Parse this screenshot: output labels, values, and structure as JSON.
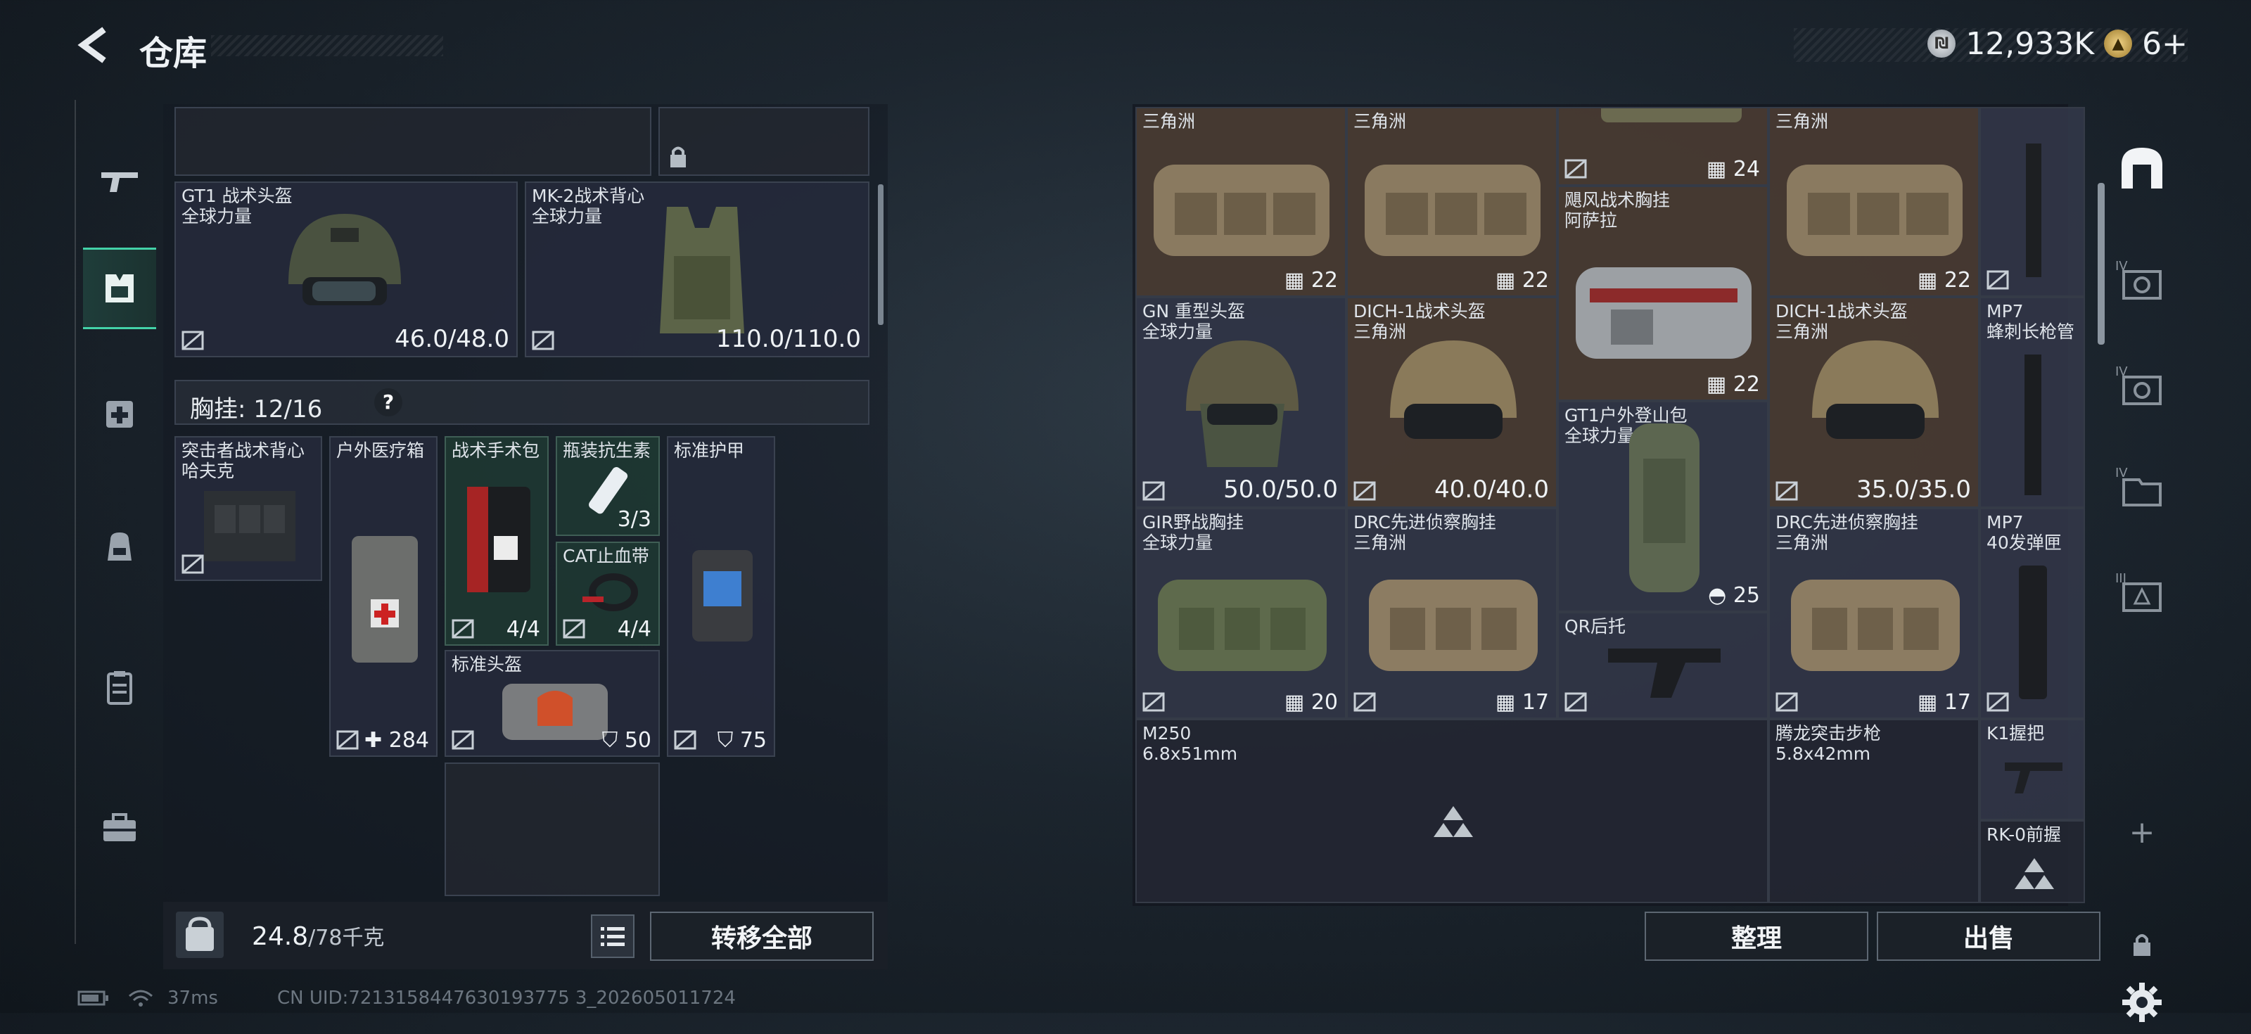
{
  "header": {
    "title": "仓库",
    "currencies": [
      {
        "icon": "silver-coin-icon",
        "value": "12,933K"
      },
      {
        "icon": "gold-coin-icon",
        "value": "6+"
      }
    ]
  },
  "left_nav": [
    {
      "name": "weapon-nav-icon"
    },
    {
      "name": "equipment-nav-icon",
      "active": true
    },
    {
      "name": "medical-nav-icon"
    },
    {
      "name": "backpack-nav-icon"
    },
    {
      "name": "clipboard-nav-icon"
    },
    {
      "name": "toolbox-nav-icon"
    }
  ],
  "equipment": {
    "helmet": {
      "name": "GT1 战术头盔",
      "sub": "全球力量",
      "durability": "46.0/48.0"
    },
    "armor": {
      "name": "MK-2战术背心",
      "sub": "全球力量",
      "durability": "110.0/110.0"
    },
    "chest_rig_label": "胸挂: 12/16",
    "chest_item": {
      "name": "突击者战术背心",
      "sub": "哈夫克"
    },
    "items": [
      {
        "name": "户外医疗箱",
        "value": "284"
      },
      {
        "name": "战术手术包",
        "value": "4/4"
      },
      {
        "name": "瓶装抗生素",
        "value": "3/3"
      },
      {
        "name": "CAT止血带",
        "value": "4/4"
      },
      {
        "name": "标准护甲",
        "value": "75"
      },
      {
        "name": "标准头盔",
        "value": "50"
      }
    ]
  },
  "bottom_left": {
    "weight": "24.8",
    "weight_unit": "/78千克",
    "transfer_all": "转移全部"
  },
  "storage": {
    "cells": [
      {
        "name": "三角洲",
        "value": "22"
      },
      {
        "name": "三角洲",
        "value": "22"
      },
      {
        "name": "",
        "value": "24"
      },
      {
        "name": "三角洲",
        "value": "22"
      },
      {
        "name": "飓风战术胸挂",
        "sub": "阿萨拉",
        "value": "22"
      },
      {
        "name": "GN 重型头盔",
        "sub": "全球力量",
        "value": "50.0/50.0"
      },
      {
        "name": "DICH-1战术头盔",
        "sub": "三角洲",
        "value": "40.0/40.0"
      },
      {
        "name": "DICH-1战术头盔",
        "sub": "三角洲",
        "value": "35.0/35.0"
      },
      {
        "name": "MP7",
        "sub": "蜂刺长枪管"
      },
      {
        "name": "GT1户外登山包",
        "sub": "全球力量",
        "value": "25"
      },
      {
        "name": "GIR野战胸挂",
        "sub": "全球力量",
        "value": "20"
      },
      {
        "name": "DRC先进侦察胸挂",
        "sub": "三角洲",
        "value": "17"
      },
      {
        "name": "DRC先进侦察胸挂",
        "sub": "三角洲",
        "value": "17"
      },
      {
        "name": "MP7",
        "sub": "40发弹匣"
      },
      {
        "name": "QR后托"
      },
      {
        "name": "M250",
        "sub": "6.8x51mm"
      },
      {
        "name": "腾龙突击步枪",
        "sub": "5.8x42mm"
      },
      {
        "name": "K1握把"
      },
      {
        "name": "RK-0前握"
      }
    ],
    "sort_label": "整理",
    "sell_label": "出售"
  },
  "right_nav": [
    {
      "label": "IV"
    },
    {
      "label": "IV"
    },
    {
      "label": "IV"
    },
    {
      "label": "III"
    },
    {
      "label": "+"
    }
  ],
  "status": {
    "ping": "37ms",
    "uid": "CN UID:7213158447630193775 3_202605011724"
  }
}
